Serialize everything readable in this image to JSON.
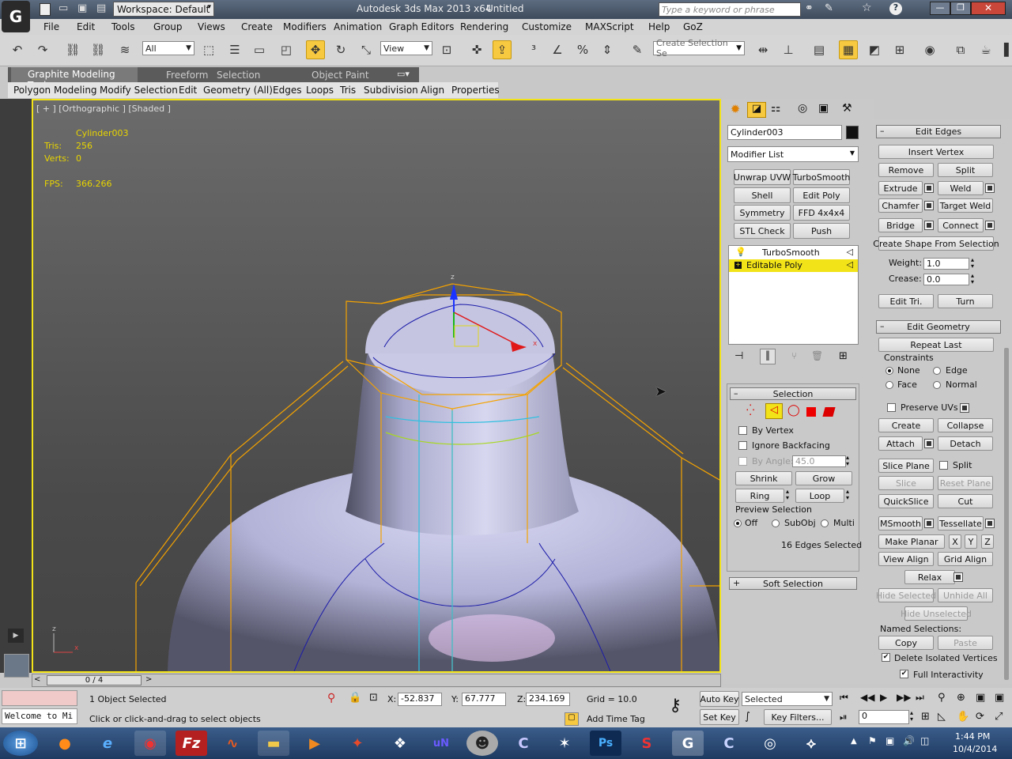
{
  "title_bar": {
    "workspace": "Workspace: Default",
    "app_title": "Autodesk 3ds Max  2013 x64",
    "doc_title": "Untitled",
    "search_placeholder": "Type a keyword or phrase"
  },
  "menus": [
    "File",
    "Edit",
    "Tools",
    "Group",
    "Views",
    "Create",
    "Modifiers",
    "Animation",
    "Graph Editors",
    "Rendering",
    "Customize",
    "MAXScript",
    "Help",
    "GoZ"
  ],
  "toolbar": {
    "filter": "All",
    "ref_coord": "View",
    "selection_set": "Create Selection Se"
  },
  "ribbon": {
    "tabs": [
      "Graphite Modeling Tools",
      "Freeform",
      "Selection",
      "Object Paint"
    ],
    "panels": [
      "Polygon Modeling",
      "Modify Selection",
      "Edit",
      "Geometry (All)",
      "Edges",
      "Loops",
      "Tris",
      "Subdivision",
      "Align",
      "Properties"
    ]
  },
  "viewport": {
    "label": "[ + ] [Orthographic ] [Shaded ]",
    "stats": {
      "object": "Cylinder003",
      "tris_label": "Tris:",
      "tris": "256",
      "verts_label": "Verts:",
      "verts": "0",
      "fps_label": "FPS:",
      "fps": "366.266"
    },
    "timeline": "0 / 4"
  },
  "command_panel": {
    "object_name": "Cylinder003",
    "modifier_list": "Modifier List",
    "modifier_buttons": [
      "Unwrap UVW",
      "TurboSmooth",
      "Shell",
      "Edit Poly",
      "Symmetry",
      "FFD 4x4x4",
      "STL Check",
      "Push"
    ],
    "stack": [
      "TurboSmooth",
      "Editable Poly"
    ],
    "selection": {
      "title": "Selection",
      "by_vertex": "By Vertex",
      "ignore_backfacing": "Ignore Backfacing",
      "by_angle": "By Angle:",
      "angle": "45.0",
      "shrink": "Shrink",
      "grow": "Grow",
      "ring": "Ring",
      "loop": "Loop",
      "preview": "Preview Selection",
      "preview_opts": [
        "Off",
        "SubObj",
        "Multi"
      ],
      "status": "16 Edges Selected"
    },
    "soft_selection": "Soft Selection"
  },
  "edit_edges": {
    "title": "Edit Edges",
    "insert_vertex": "Insert Vertex",
    "remove": "Remove",
    "split": "Split",
    "extrude": "Extrude",
    "weld": "Weld",
    "chamfer": "Chamfer",
    "target_weld": "Target Weld",
    "bridge": "Bridge",
    "connect": "Connect",
    "create_shape": "Create Shape From Selection",
    "weight_label": "Weight:",
    "weight": "1.0",
    "crease_label": "Crease:",
    "crease": "0.0",
    "edit_tri": "Edit Tri.",
    "turn": "Turn"
  },
  "edit_geometry": {
    "title": "Edit Geometry",
    "repeat_last": "Repeat Last",
    "constraints": "Constraints",
    "constraint_opts": [
      "None",
      "Edge",
      "Face",
      "Normal"
    ],
    "preserve_uvs": "Preserve UVs",
    "create": "Create",
    "collapse": "Collapse",
    "attach": "Attach",
    "detach": "Detach",
    "slice_plane": "Slice Plane",
    "split": "Split",
    "slice": "Slice",
    "reset_plane": "Reset Plane",
    "quickslice": "QuickSlice",
    "cut": "Cut",
    "msmooth": "MSmooth",
    "tessellate": "Tessellate",
    "make_planar": "Make Planar",
    "x": "X",
    "y": "Y",
    "z": "Z",
    "view_align": "View Align",
    "grid_align": "Grid Align",
    "relax": "Relax",
    "hide_selected": "Hide Selected",
    "unhide_all": "Unhide All",
    "hide_unselected": "Hide Unselected",
    "named_sel": "Named Selections:",
    "copy": "Copy",
    "paste": "Paste",
    "delete_isolated": "Delete Isolated Vertices",
    "full_interactivity": "Full Interactivity"
  },
  "status": {
    "welcome": "Welcome to Mi",
    "selected_count": "1 Object Selected",
    "prompt": "Click or click-and-drag to select objects",
    "x": "-52.837",
    "y": "67.777",
    "z": "234.169",
    "grid": "Grid = 10.0",
    "add_time_tag": "Add Time Tag",
    "auto_key": "Auto Key",
    "set_key": "Set Key",
    "key_mode": "Selected",
    "key_filters": "Key Filters...",
    "frame": "0"
  },
  "taskbar": {
    "time": "1:44 PM",
    "date": "10/4/2014"
  },
  "colors": {
    "accent": "#f2e318",
    "stat_text": "#e8d400",
    "active_btn": "#f7c941"
  }
}
